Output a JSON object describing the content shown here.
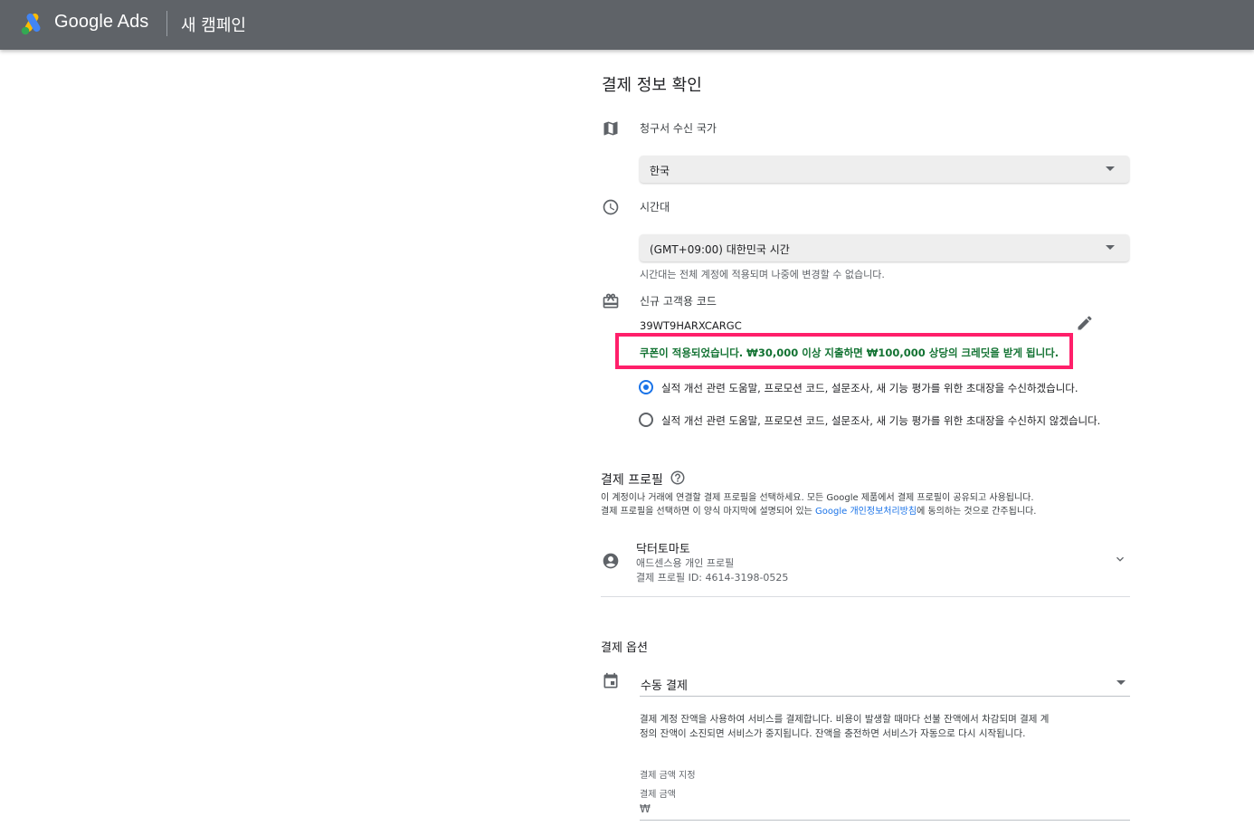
{
  "header": {
    "brand": "Google Ads",
    "campaign": "새 캠페인"
  },
  "billing": {
    "title": "결제 정보 확인",
    "country": {
      "label": "청구서 수신 국가",
      "value": "한국"
    },
    "timezone": {
      "label": "시간대",
      "value": "(GMT+09:00) 대한민국 시간",
      "note": "시간대는 전체 계정에 적용되며 나중에 변경할 수 없습니다."
    },
    "promo": {
      "label": "신규 고객용 코드",
      "code": "39WT9HARXCARGC",
      "applied_message": "쿠폰이 적용되었습니다. ₩30,000 이상 지출하면 ₩100,000 상당의 크레딧을 받게 됩니다."
    },
    "consent": {
      "options": [
        "실적 개선 관련 도움말, 프로모션 코드, 설문조사, 새 기능 평가를 위한 초대장을 수신하겠습니다.",
        "실적 개선 관련 도움말, 프로모션 코드, 설문조사, 새 기능 평가를 위한 초대장을 수신하지 않겠습니다."
      ],
      "selected_index": 0
    }
  },
  "profile": {
    "title": "결제 프로필",
    "desc_line1": "이 계정이나 거래에 연결할 결제 프로필을 선택하세요. 모든 Google 제품에서 결제 프로필이 공유되고 사용됩니다.",
    "desc_line2_prefix": "결제 프로필을 선택하면 이 양식 마지막에 설명되어 있는 ",
    "desc_link": "Google 개인정보처리방침",
    "desc_line2_suffix": "에 동의하는 것으로 간주됩니다.",
    "name": "닥터토마토",
    "type": "애드센스용 개인 프로필",
    "id": "결제 프로필 ID: 4614-3198-0525"
  },
  "payment": {
    "title": "결제 옵션",
    "method": "수동 결제",
    "desc_line1": "결제 계정 잔액을 사용하여 서비스를 결제합니다. 비용이 발생할 때마다 선불 잔액에서 차감되며 결제 계",
    "desc_line2": "정의 잔액이 소진되면 서비스가 중지됩니다. 잔액을 충전하면 서비스가 자동으로 다시 시작됩니다.",
    "amount_heading": "결제 금액 지정",
    "amount_label": "결제 금액",
    "currency_symbol": "₩"
  },
  "colors": {
    "topbar": "#5f6368",
    "highlight": "#ff1f6a",
    "success": "#137333",
    "accent": "#1a73e8"
  }
}
